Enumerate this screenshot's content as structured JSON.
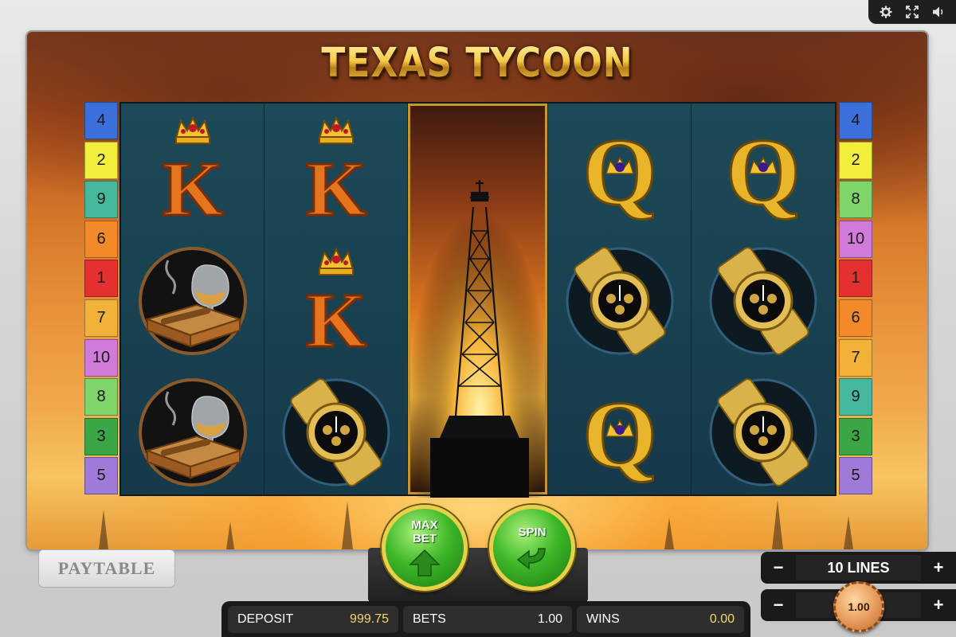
{
  "game": {
    "title": "TEXAS TYCOON"
  },
  "toolbar": {
    "icons": [
      "gear-icon",
      "fullscreen-icon",
      "sound-icon"
    ]
  },
  "paylines": {
    "left": [
      {
        "n": "4",
        "color": "#3b6fd9"
      },
      {
        "n": "2",
        "color": "#f2ee3c"
      },
      {
        "n": "9",
        "color": "#46b89e"
      },
      {
        "n": "6",
        "color": "#f28a2a"
      },
      {
        "n": "1",
        "color": "#e53030"
      },
      {
        "n": "7",
        "color": "#f2b23a"
      },
      {
        "n": "10",
        "color": "#d07ad9"
      },
      {
        "n": "8",
        "color": "#7fd46a"
      },
      {
        "n": "3",
        "color": "#3aa645"
      },
      {
        "n": "5",
        "color": "#a07ad9"
      }
    ],
    "right": [
      {
        "n": "4",
        "color": "#3b6fd9"
      },
      {
        "n": "2",
        "color": "#f2ee3c"
      },
      {
        "n": "8",
        "color": "#7fd46a"
      },
      {
        "n": "10",
        "color": "#d07ad9"
      },
      {
        "n": "1",
        "color": "#e53030"
      },
      {
        "n": "6",
        "color": "#f28a2a"
      },
      {
        "n": "7",
        "color": "#f2b23a"
      },
      {
        "n": "9",
        "color": "#46b89e"
      },
      {
        "n": "3",
        "color": "#3aa645"
      },
      {
        "n": "5",
        "color": "#a07ad9"
      }
    ]
  },
  "reels": [
    [
      "king",
      "cigar-cognac",
      "cigar-cognac"
    ],
    [
      "king",
      "king",
      "gold-watch"
    ],
    [
      "oil-derrick-expanded"
    ],
    [
      "queen",
      "gold-watch",
      "queen"
    ],
    [
      "queen",
      "gold-watch",
      "gold-watch"
    ]
  ],
  "buttons": {
    "paytable": "PAYTABLE",
    "maxbet": "MAX BET",
    "spin": "SPIN"
  },
  "info": {
    "deposit_label": "DEPOSIT",
    "deposit_value": "999.75",
    "bets_label": "BETS",
    "bets_value": "1.00",
    "wins_label": "WINS",
    "wins_value": "0.00"
  },
  "lines_selector": {
    "value": "10 LINES",
    "minus": "−",
    "plus": "+"
  },
  "bet_selector": {
    "value": "1.00",
    "minus": "−",
    "plus": "+"
  }
}
